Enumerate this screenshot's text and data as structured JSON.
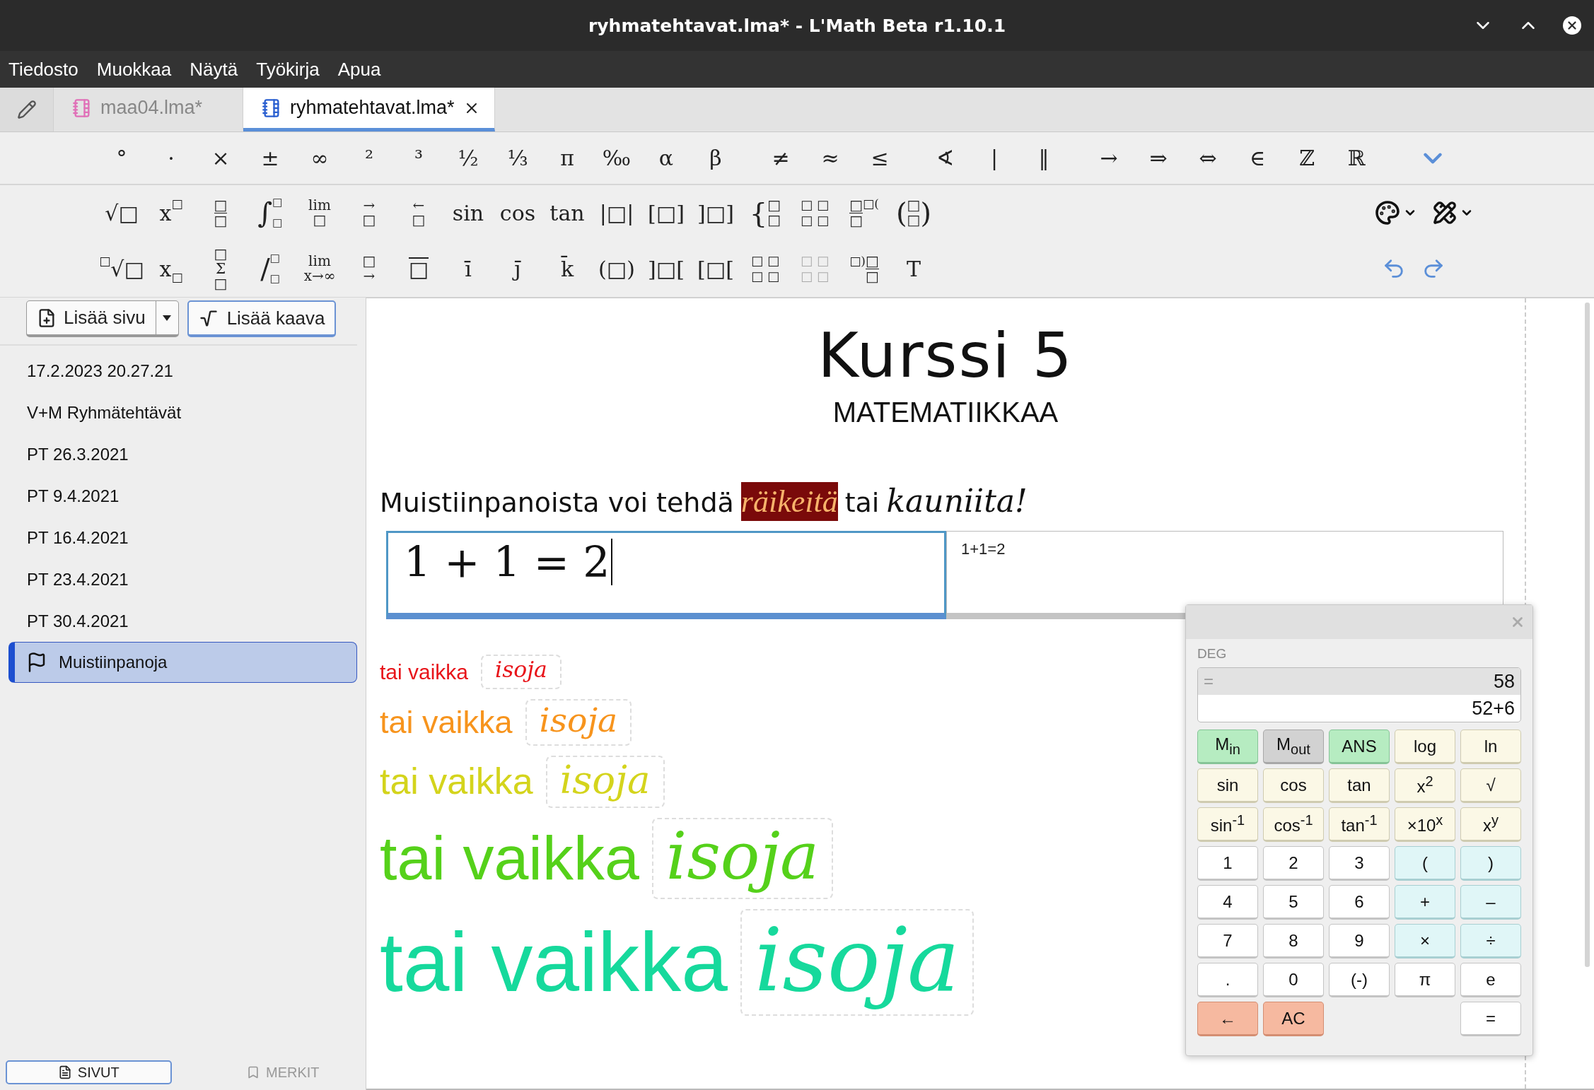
{
  "window": {
    "title": "ryhmatehtavat.lma* - L'Math Beta r1.10.1"
  },
  "menu": [
    "Tiedosto",
    "Muokkaa",
    "Näytä",
    "Työkirja",
    "Apua"
  ],
  "tabs": [
    {
      "label": "maa04.lma*",
      "selected": false,
      "closable": false
    },
    {
      "label": "ryhmatehtavat.lma*",
      "selected": true,
      "closable": true
    }
  ],
  "toolbar": {
    "symbols": [
      [
        "°",
        "·",
        "×",
        "±",
        "∞",
        "²",
        "³",
        "½",
        "⅓",
        "π",
        "‰",
        "α",
        "β"
      ],
      [
        "≠",
        "≈",
        "≤"
      ],
      [
        "∢",
        "|",
        "‖"
      ],
      [
        "→",
        "⇒",
        "⇔",
        "∈",
        "ℤ",
        "ℝ"
      ]
    ],
    "templates": [
      [
        {
          "kind": "text",
          "text": "√□"
        },
        {
          "kind": "sup",
          "base": "x",
          "script": "□"
        },
        {
          "kind": "stack",
          "lines": [
            "□",
            "□"
          ],
          "bar": true
        },
        {
          "kind": "supsub",
          "base": "∫",
          "sup": "□",
          "sub": "□"
        },
        {
          "kind": "stack",
          "lines": [
            "lim",
            "□"
          ]
        },
        {
          "kind": "stack",
          "lines": [
            "→",
            "□"
          ]
        },
        {
          "kind": "stack",
          "lines": [
            "←",
            "□"
          ]
        },
        {
          "kind": "text",
          "text": "sin"
        },
        {
          "kind": "text",
          "text": "cos"
        },
        {
          "kind": "text",
          "text": "tan"
        },
        {
          "kind": "text",
          "text": "|□|"
        },
        {
          "kind": "text",
          "text": "[□]"
        },
        {
          "kind": "text",
          "text": "]□]"
        },
        {
          "kind": "stack",
          "lines": [
            "□",
            "□"
          ],
          "left": "{"
        },
        {
          "kind": "grid",
          "cells": [
            "□",
            "□",
            "□",
            "□"
          ],
          "faint": false
        },
        {
          "kind": "stack",
          "lines": [
            "□",
            "□"
          ],
          "bar": true,
          "note": "□("
        },
        {
          "kind": "stack",
          "lines": [
            "□",
            "□"
          ],
          "left": "(",
          "right": ")"
        }
      ],
      [
        {
          "kind": "presup",
          "sup": "□",
          "base": "√□"
        },
        {
          "kind": "sub",
          "base": "x",
          "script": "□"
        },
        {
          "kind": "stack",
          "lines": [
            "□",
            "Σ",
            "□"
          ]
        },
        {
          "kind": "supsub",
          "base": "/",
          "sup": "□",
          "sub": "□"
        },
        {
          "kind": "stack",
          "lines": [
            "lim",
            "x→∞"
          ]
        },
        {
          "kind": "stack",
          "lines": [
            "□",
            "→"
          ]
        },
        {
          "kind": "overline",
          "base": "□"
        },
        {
          "kind": "text",
          "text": "ī"
        },
        {
          "kind": "text",
          "text": "j̄"
        },
        {
          "kind": "text",
          "text": "k̄"
        },
        {
          "kind": "text",
          "text": "(□)"
        },
        {
          "kind": "text",
          "text": "]□["
        },
        {
          "kind": "text",
          "text": "[□["
        },
        {
          "kind": "grid",
          "cells": [
            "□",
            "□",
            "□",
            "□"
          ],
          "faint": false
        },
        {
          "kind": "grid",
          "cells": [
            "□",
            "□",
            "□",
            "□"
          ],
          "faint": true
        },
        {
          "kind": "stack",
          "lines": [
            "□",
            "□"
          ],
          "bar": true,
          "lead": "□)"
        },
        {
          "kind": "text",
          "text": "T"
        }
      ]
    ]
  },
  "sidebar": {
    "add_page": "Lisää sivu",
    "add_formula": "Lisää kaava",
    "pages": [
      {
        "label": "17.2.2023 20.27.21",
        "selected": false,
        "flagged": false
      },
      {
        "label": "V+M Ryhmätehtävät",
        "selected": false,
        "flagged": false
      },
      {
        "label": "PT 26.3.2021",
        "selected": false,
        "flagged": false
      },
      {
        "label": "PT 9.4.2021",
        "selected": false,
        "flagged": false
      },
      {
        "label": "PT 16.4.2021",
        "selected": false,
        "flagged": false
      },
      {
        "label": "PT 23.4.2021",
        "selected": false,
        "flagged": false
      },
      {
        "label": "PT 30.4.2021",
        "selected": false,
        "flagged": false
      },
      {
        "label": "Muistiinpanoja",
        "selected": true,
        "flagged": true
      }
    ],
    "bottom_tabs": [
      {
        "kind": "pages",
        "label": "SIVUT",
        "selected": true
      },
      {
        "kind": "bookmarks",
        "label": "MERKIT",
        "selected": false
      }
    ]
  },
  "document": {
    "title": "Kurssi 5",
    "subtitle": "MATEMATIIKKAA",
    "sentence": [
      {
        "kind": "plain",
        "text": "Muistiinpanoista voi tehdä"
      },
      {
        "kind": "highlight",
        "text": "räikeitä"
      },
      {
        "kind": "plain",
        "text": "tai"
      },
      {
        "kind": "math",
        "text": "kauniita!"
      }
    ],
    "math_input": {
      "value": "1 + 1 = 2",
      "preview": "1+1=2"
    },
    "size_rows": [
      {
        "text": "tai vaikka",
        "math": "isoja",
        "color": "#e8141a"
      },
      {
        "text": "tai vaikka",
        "math": "isoja",
        "color": "#f7941d"
      },
      {
        "text": "tai vaikka",
        "math": "isoja",
        "color": "#d4d41c"
      },
      {
        "text": "tai vaikka",
        "math": "isoja",
        "color": "#55d11a"
      },
      {
        "text": "tai vaikka",
        "math": "isoja",
        "color": "#16d99c"
      }
    ]
  },
  "calculator": {
    "mode": "DEG",
    "result_sign": "=",
    "result": "58",
    "expression": "52+6",
    "keys": [
      {
        "kind": "memory",
        "label": "M$_{in}$"
      },
      {
        "kind": "recall",
        "label": "M$_{out}$"
      },
      {
        "kind": "memory",
        "label": "ANS"
      },
      {
        "kind": "function",
        "label": "log"
      },
      {
        "kind": "function",
        "label": "ln"
      },
      {
        "kind": "function",
        "label": "sin"
      },
      {
        "kind": "function",
        "label": "cos"
      },
      {
        "kind": "function",
        "label": "tan"
      },
      {
        "kind": "function",
        "label": "x$^{2}$"
      },
      {
        "kind": "function",
        "label": "√"
      },
      {
        "kind": "function",
        "label": "sin$^{-1}$"
      },
      {
        "kind": "function",
        "label": "cos$^{-1}$"
      },
      {
        "kind": "function",
        "label": "tan$^{-1}$"
      },
      {
        "kind": "function",
        "label": "×10$^{x}$"
      },
      {
        "kind": "function",
        "label": "x$^{y}$"
      },
      {
        "kind": "digit",
        "label": "1"
      },
      {
        "kind": "digit",
        "label": "2"
      },
      {
        "kind": "digit",
        "label": "3"
      },
      {
        "kind": "operator",
        "label": "("
      },
      {
        "kind": "operator",
        "label": ")"
      },
      {
        "kind": "digit",
        "label": "4"
      },
      {
        "kind": "digit",
        "label": "5"
      },
      {
        "kind": "digit",
        "label": "6"
      },
      {
        "kind": "operator",
        "label": "+"
      },
      {
        "kind": "operator",
        "label": "–"
      },
      {
        "kind": "digit",
        "label": "7"
      },
      {
        "kind": "digit",
        "label": "8"
      },
      {
        "kind": "digit",
        "label": "9"
      },
      {
        "kind": "operator",
        "label": "×"
      },
      {
        "kind": "operator",
        "label": "÷"
      },
      {
        "kind": "digit",
        "label": "."
      },
      {
        "kind": "digit",
        "label": "0"
      },
      {
        "kind": "digit",
        "label": "(-)"
      },
      {
        "kind": "digit",
        "label": "π"
      },
      {
        "kind": "digit",
        "label": "e"
      },
      {
        "kind": "erase",
        "label": "←"
      },
      {
        "kind": "erase",
        "label": "AC"
      },
      {
        "kind": "blank"
      },
      {
        "kind": "blank"
      },
      {
        "kind": "digit",
        "label": "="
      }
    ]
  }
}
